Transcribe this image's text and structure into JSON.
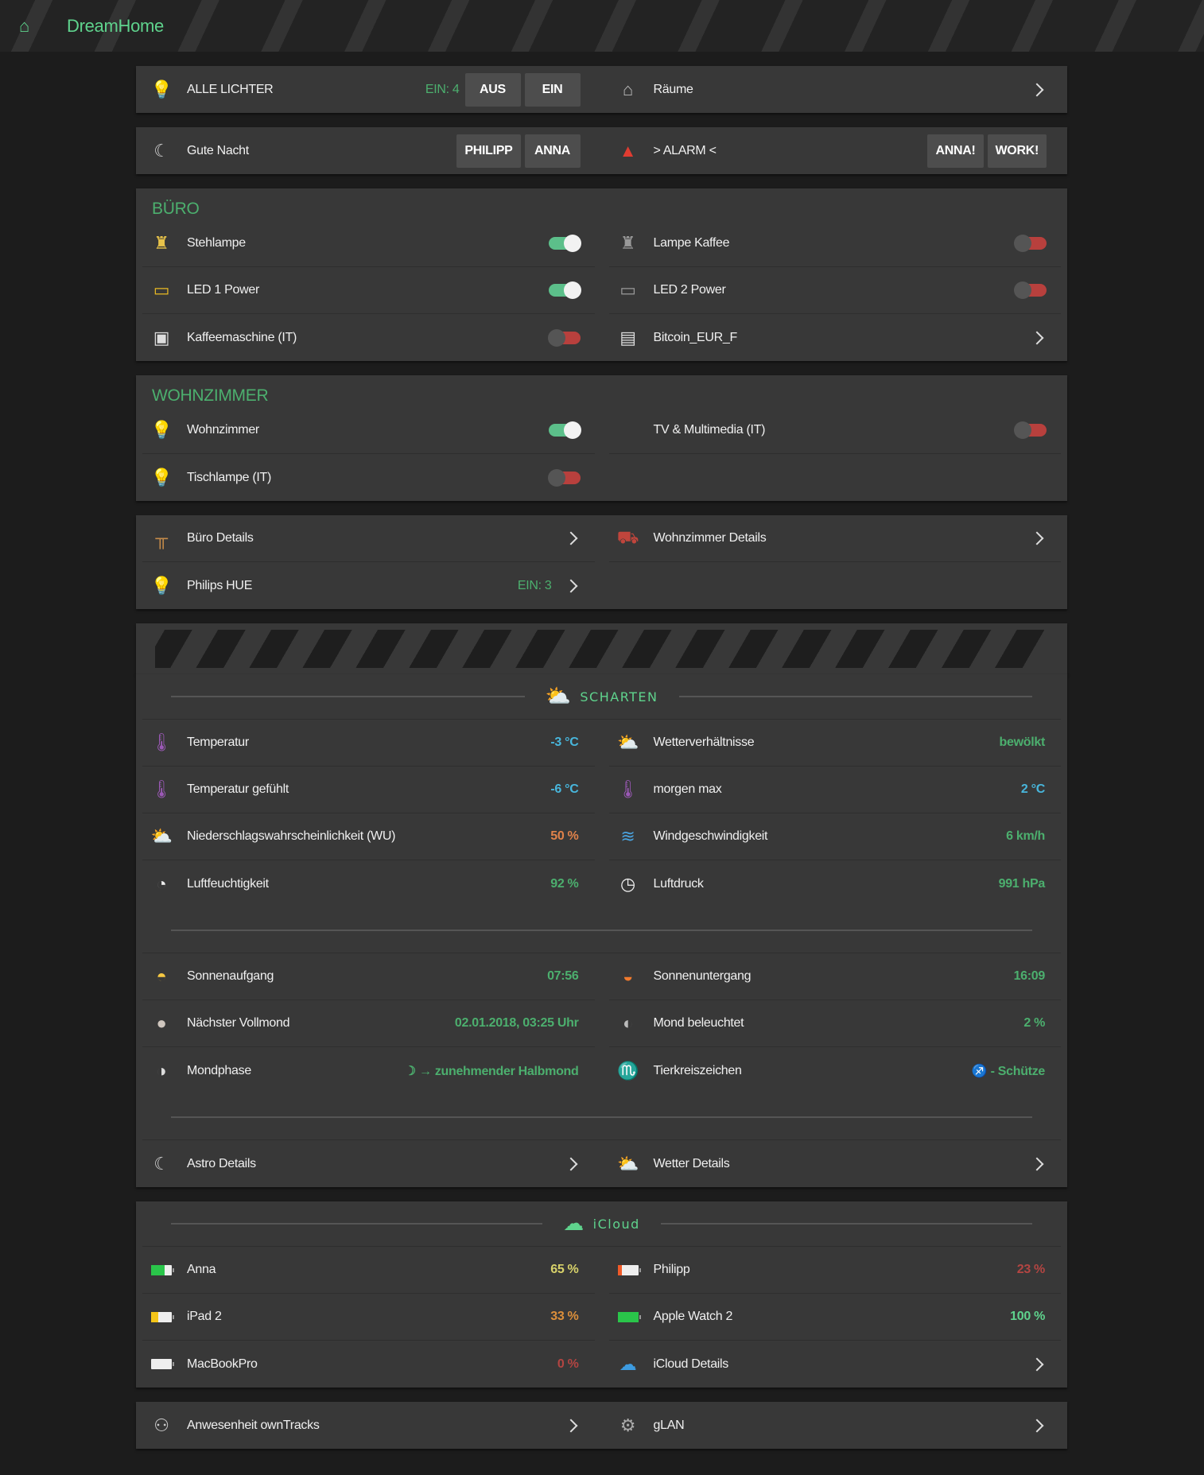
{
  "header": {
    "title": "DreamHome"
  },
  "colors": {
    "green": "#4caf6e",
    "cyan": "#48b6dc",
    "orange": "#e0824a",
    "red": "#b34542",
    "yellow": "#d8d26a",
    "amber": "#dc8f3a",
    "bright": "#5fd38d"
  },
  "panels": [
    {
      "rows": [
        [
          {
            "icon": "bulb-icon",
            "label": "ALLE LICHTER",
            "value": "EIN: 4",
            "vc": "green",
            "light": true,
            "buttons": [
              "AUS",
              "EIN"
            ]
          },
          {
            "icon": "house-icon",
            "label": "Räume",
            "chevron": true
          }
        ]
      ]
    },
    {
      "rows": [
        [
          {
            "icon": "moon-icon",
            "label": "Gute Nacht",
            "buttons": [
              "PHILIPP",
              "ANNA"
            ]
          },
          {
            "icon": "alarm-light-icon",
            "label": "> ALARM <",
            "buttons": [
              "ANNA!",
              "WORK!"
            ]
          }
        ]
      ]
    },
    {
      "title": "BÜRO",
      "rows": [
        [
          {
            "icon": "floor-lamp-icon",
            "label": "Stehlampe",
            "toggle": true
          },
          {
            "icon": "floor-lamp-off-icon",
            "label": "Lampe Kaffee",
            "toggle": false
          }
        ],
        [
          {
            "icon": "led-strip-icon",
            "label": "LED 1 Power",
            "toggle": true
          },
          {
            "icon": "led-strip-off-icon",
            "label": "LED 2 Power",
            "toggle": false
          }
        ],
        [
          {
            "icon": "coffee-machine-icon",
            "label": "Kaffeemaschine (IT)",
            "toggle": false
          },
          {
            "icon": "document-icon",
            "label": "Bitcoin_EUR_F",
            "chevron": true
          }
        ]
      ]
    },
    {
      "title": "WOHNZIMMER",
      "rows": [
        [
          {
            "icon": "bulb-icon",
            "label": "Wohnzimmer",
            "toggle": true
          },
          {
            "icon": "",
            "label": "TV & Multimedia (IT)",
            "toggle": false
          }
        ],
        [
          {
            "icon": "bulb-off-icon",
            "label": "Tischlampe (IT)",
            "toggle": false
          },
          null
        ]
      ]
    },
    {
      "rows": [
        [
          {
            "icon": "desk-icon",
            "label": "Büro Details",
            "chevron": true
          },
          {
            "icon": "sofa-icon",
            "label": "Wohnzimmer Details",
            "chevron": true
          }
        ],
        [
          {
            "icon": "bulb-icon",
            "label": "Philips HUE",
            "value": "EIN: 3",
            "vc": "green",
            "light": true,
            "chevron": true
          },
          null
        ]
      ]
    },
    {
      "stripes": true
    },
    {
      "section": {
        "icon": "cloud-sun-icon",
        "name": "SCHARTEN"
      },
      "rows": [
        [
          {
            "icon": "thermometer-icon",
            "label": "Temperatur",
            "value": "-3 °C",
            "vc": "cyan"
          },
          {
            "icon": "sun-cloud-icon",
            "label": "Wetterverhältnisse",
            "value": "bewölkt",
            "vc": "green"
          }
        ],
        [
          {
            "icon": "thermometer-icon",
            "label": "Temperatur gefühlt",
            "value": "-6 °C",
            "vc": "cyan"
          },
          {
            "icon": "thermometer-icon",
            "label": "morgen max",
            "value": "2 °C",
            "vc": "cyan"
          }
        ],
        [
          {
            "icon": "sun-cloud-icon",
            "label": "Niederschlagswahrscheinlichkeit (WU)",
            "value": "50 %",
            "vc": "orange"
          },
          {
            "icon": "wind-icon",
            "label": "Windgeschwindigkeit",
            "value": "6 km/h",
            "vc": "green"
          }
        ],
        [
          {
            "icon": "hygrometer-icon",
            "label": "Luftfeuchtigkeit",
            "value": "92 %",
            "vc": "green"
          },
          {
            "icon": "barometer-icon",
            "label": "Luftdruck",
            "value": "991 hPa",
            "vc": "green"
          }
        ]
      ],
      "sep": true,
      "rows2": [
        [
          {
            "icon": "sunrise-icon",
            "label": "Sonnenaufgang",
            "value": "07:56",
            "vc": "green"
          },
          {
            "icon": "sunset-icon",
            "label": "Sonnenuntergang",
            "value": "16:09",
            "vc": "green"
          }
        ],
        [
          {
            "icon": "full-moon-icon",
            "label": "Nächster Vollmond",
            "value": "02.01.2018, 03:25 Uhr",
            "vc": "green"
          },
          {
            "icon": "moon-illuminated-icon",
            "label": "Mond beleuchtet",
            "value": "2 %",
            "vc": "green"
          }
        ],
        [
          {
            "icon": "moon-phase-icon",
            "label": "Mondphase",
            "value": "☽ → zunehmender Halbmond",
            "vc": "green"
          },
          {
            "icon": "zodiac-icon",
            "label": "Tierkreiszeichen",
            "value": "♐ - Schütze",
            "vc": "green"
          }
        ]
      ],
      "rows3": [
        [
          {
            "icon": "moon-icon",
            "label": "Astro Details",
            "chevron": true
          },
          {
            "icon": "sun-cloud-icon",
            "label": "Wetter Details",
            "chevron": true
          }
        ]
      ]
    },
    {
      "section": {
        "icon": "cloud-icon",
        "name": "iCloud"
      },
      "rows": [
        [
          {
            "icon": "battery-icon",
            "battery": 65,
            "bc": "#2ac54a",
            "label": "Anna",
            "value": "65 %",
            "vc": "yellow"
          },
          {
            "icon": "battery-icon",
            "battery": 23,
            "bc": "#f05a28",
            "label": "Philipp",
            "value": "23 %",
            "vc": "red"
          }
        ],
        [
          {
            "icon": "battery-icon",
            "battery": 33,
            "bc": "#f5c518",
            "label": "iPad 2",
            "value": "33 %",
            "vc": "amber"
          },
          {
            "icon": "battery-icon",
            "battery": 100,
            "bc": "#2ac54a",
            "label": "Apple Watch 2",
            "value": "100 %",
            "vc": "bright"
          }
        ],
        [
          {
            "icon": "battery-icon",
            "battery": 0,
            "bc": "#2ac54a",
            "label": "MacBookPro",
            "value": "0 %",
            "vc": "red"
          },
          {
            "icon": "icloud-sync-icon",
            "label": "iCloud Details",
            "chevron": true
          }
        ]
      ]
    },
    {
      "rows": [
        [
          {
            "icon": "person-icon",
            "label": "Anwesenheit ownTracks",
            "chevron": true
          },
          {
            "icon": "gear-icon",
            "label": "gLAN",
            "chevron": true
          }
        ]
      ]
    }
  ]
}
